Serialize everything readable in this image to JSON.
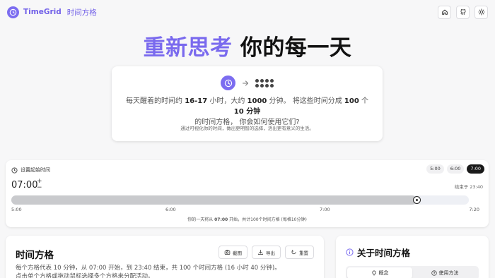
{
  "brand": {
    "name": "TimeGrid",
    "subtitle": "时间方格"
  },
  "header": {
    "icons": [
      "home-icon",
      "github-icon",
      "sun-icon"
    ]
  },
  "hero": {
    "title_accent": "重新思考",
    "title_rest": " 你的每一天",
    "intro_line1_a": "每天醒着的时间约 ",
    "intro_hours": "16-17",
    "intro_line1_b": " 小时，大约 ",
    "intro_minutes": "1000",
    "intro_line1_c": " 分钟。 将这些时间分成 ",
    "intro_count": "100",
    "intro_line1_d": " 个 ",
    "intro_block": "10 分钟",
    "intro_line2": "的时间方格， 你会如何使用它们?",
    "intro_sub": "通过可视化你的时间，做出更明智的选择，活出更有意义的生活。"
  },
  "time_setting": {
    "label": "设置起始时间",
    "presets": [
      "5:00",
      "6:00",
      "7:00"
    ],
    "active_preset": "7:00",
    "start_time": "07:00",
    "end_text": "结束于 23:40",
    "slider_fraction": 0.885,
    "ticks": [
      "5:00",
      "6:00",
      "7:00",
      "7:20"
    ],
    "summary_a": "你的一天将从 ",
    "summary_time": "07:00",
    "summary_b": " 开始，共计100个时间方格 (每格10分钟)"
  },
  "grid_section": {
    "title": "时间方格",
    "buttons": {
      "screenshot": "截图",
      "export": "导出",
      "reset": "重置"
    },
    "desc_line1": "每个方格代表 10 分钟，从 07:00 开始，到 23:40 结束，共 100 个时间方格 (16 小时 40 分钟)。",
    "desc_line2": "点击单个方格或拖动鼠标选择多个方格来分配活动。"
  },
  "about": {
    "title": "关于时间方格",
    "tabs": [
      "概念",
      "使用方法"
    ],
    "active_tab": "概念"
  }
}
